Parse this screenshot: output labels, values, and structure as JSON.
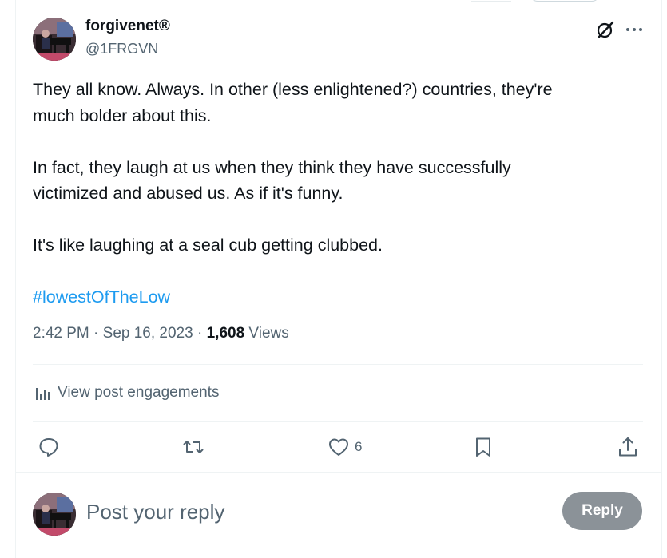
{
  "author": {
    "display_name": "forgivenet®",
    "handle": "@1FRGVN"
  },
  "post": {
    "paragraphs": [
      "They all know. Always. In other (less enlightened?) countries, they're\nmuch bolder about this.",
      "In fact, they laugh at us when they think they have successfully\nvictimized and abused us. As if it's funny.",
      "It's like laughing at a seal cub getting clubbed."
    ],
    "hashtag": "#lowestOfTheLow"
  },
  "meta": {
    "time": "2:42 PM",
    "separator1": " · ",
    "date": "Sep 16, 2023",
    "separator2": " · ",
    "views_count": "1,608",
    "views_label": " Views"
  },
  "engagements": {
    "label": "View post engagements"
  },
  "actions": {
    "reply_count": "",
    "repost_count": "",
    "like_count": "6",
    "bookmark_count": ""
  },
  "reply_box": {
    "placeholder": "Post your reply",
    "button_label": "Reply"
  },
  "colors": {
    "accent": "#1d9bf0",
    "text_primary": "#0f1419",
    "text_secondary": "#536471",
    "reply_button_disabled": "#8b9298",
    "divider": "#eff3f4"
  },
  "icons": {
    "grok": "grok-icon",
    "more": "more-icon",
    "engagements": "bar-chart-icon",
    "reply": "reply-icon",
    "repost": "repost-icon",
    "like": "heart-icon",
    "bookmark": "bookmark-icon",
    "share": "share-icon"
  }
}
